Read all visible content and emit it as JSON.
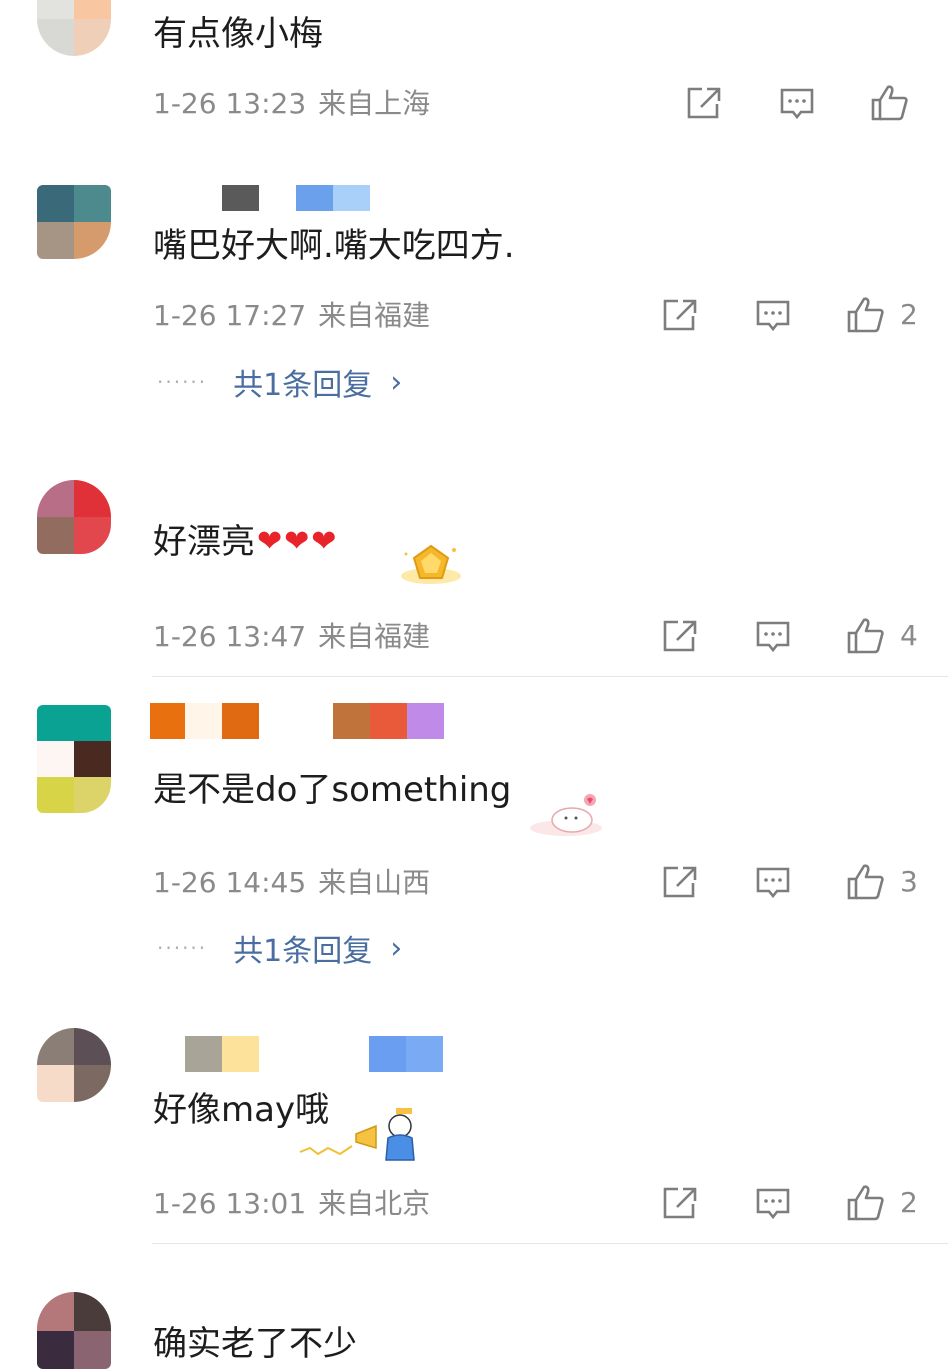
{
  "comments": [
    {
      "text": "有点像小梅",
      "time": "1-26 13:23",
      "location": "来自上海",
      "likes": ""
    },
    {
      "text": "嘴巴好大啊.嘴大吃四方.",
      "time": "1-26 17:27",
      "location": "来自福建",
      "likes": "2",
      "replies": "共1条回复"
    },
    {
      "text": "好漂亮",
      "emoji": [
        "❤",
        "❤",
        "❤"
      ],
      "time": "1-26 13:47",
      "location": "来自福建",
      "likes": "4"
    },
    {
      "text": "是不是do了something",
      "time": "1-26 14:45",
      "location": "来自山西",
      "likes": "3",
      "replies": "共1条回复"
    },
    {
      "text": "好像may哦",
      "time": "1-26 13:01",
      "location": "来自北京",
      "likes": "2"
    },
    {
      "text": "确实老了不少"
    }
  ],
  "reply_dots": "······",
  "reply_chevron": "›",
  "icons": {
    "share": "share-icon",
    "comment": "comment-icon",
    "like": "like-icon"
  },
  "colors": {
    "meta": "#8a8a8a",
    "reply_link": "#4a6ea0",
    "heart": "#e8232a"
  }
}
